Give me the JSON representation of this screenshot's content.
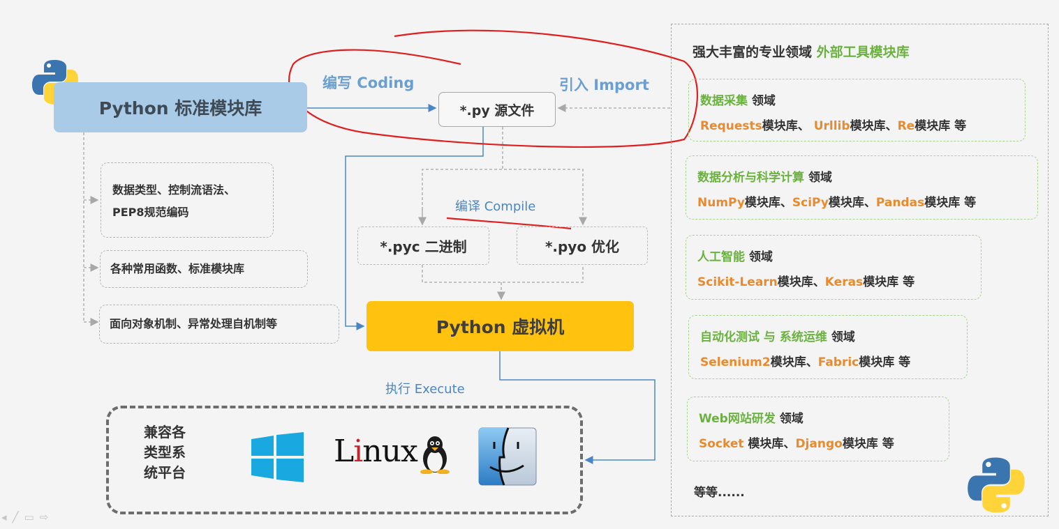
{
  "left": {
    "std_lib_title": "Python 标准模块库",
    "items": [
      [
        "数据类型、控制流语法、",
        "PEP8规范编码"
      ],
      [
        "各种常用函数、标准模块库"
      ],
      [
        "面向对象机制、异常处理自机制等"
      ]
    ]
  },
  "center": {
    "coding_label": "编写 Coding",
    "import_label": "引入 Import",
    "source_file": "*.py 源文件",
    "compile_label": "编译 Compile",
    "pyc": "*.pyc 二进制",
    "pyo": "*.pyo 优化",
    "vm": "Python 虚拟机",
    "execute_label": "执行 Execute"
  },
  "os": {
    "compat_lines": [
      "兼容各",
      "类型系",
      "统平台"
    ],
    "linux_l": "L",
    "linux_i": "i",
    "linux_rest": "nux"
  },
  "right": {
    "title_a": "强大丰富的专业领域 ",
    "title_b": "外部工具模块库",
    "fields": [
      {
        "name": "数据采集",
        "suffix": " 领域",
        "libs": [
          {
            "lib": "Requests",
            "tail": "模块库、 "
          },
          {
            "lib": "Urllib",
            "tail": "模块库、"
          },
          {
            "lib": "Re",
            "tail": "模块库 等"
          }
        ]
      },
      {
        "name": "数据分析与科学计算",
        "suffix": " 领域",
        "libs": [
          {
            "lib": "NumPy",
            "tail": "模块库、"
          },
          {
            "lib": "SciPy",
            "tail": "模块库、"
          },
          {
            "lib": "Pandas",
            "tail": "模块库 等"
          }
        ]
      },
      {
        "name": "人工智能",
        "suffix": " 领域",
        "libs": [
          {
            "lib": "Scikit-Learn",
            "tail": "模块库、"
          },
          {
            "lib": "Keras",
            "tail": "模块库 等"
          }
        ]
      },
      {
        "name": "自动化测试 与 系统运维",
        "suffix": " 领域",
        "libs": [
          {
            "lib": "Selenium2",
            "tail": "模块库、"
          },
          {
            "lib": "Fabric",
            "tail": "模块库 等"
          }
        ]
      },
      {
        "name": "Web网站研发",
        "suffix": " 领域",
        "libs": [
          {
            "lib": "Socket",
            "tail": " 模块库、"
          },
          {
            "lib": "Django",
            "tail": "模块库 等"
          }
        ]
      }
    ],
    "etc": "等等......"
  },
  "colors": {
    "std_lib_bg": "#a9cbe8",
    "vm_bg": "#ffc20e",
    "field_green": "#6ab23e",
    "lib_orange": "#e98a2c",
    "flow_blue": "#6a9fd1",
    "annotation_red": "#e01e1e"
  },
  "icons": [
    "python-logo-icon",
    "windows-logo-icon",
    "linux-tux-icon",
    "mac-finder-icon"
  ]
}
